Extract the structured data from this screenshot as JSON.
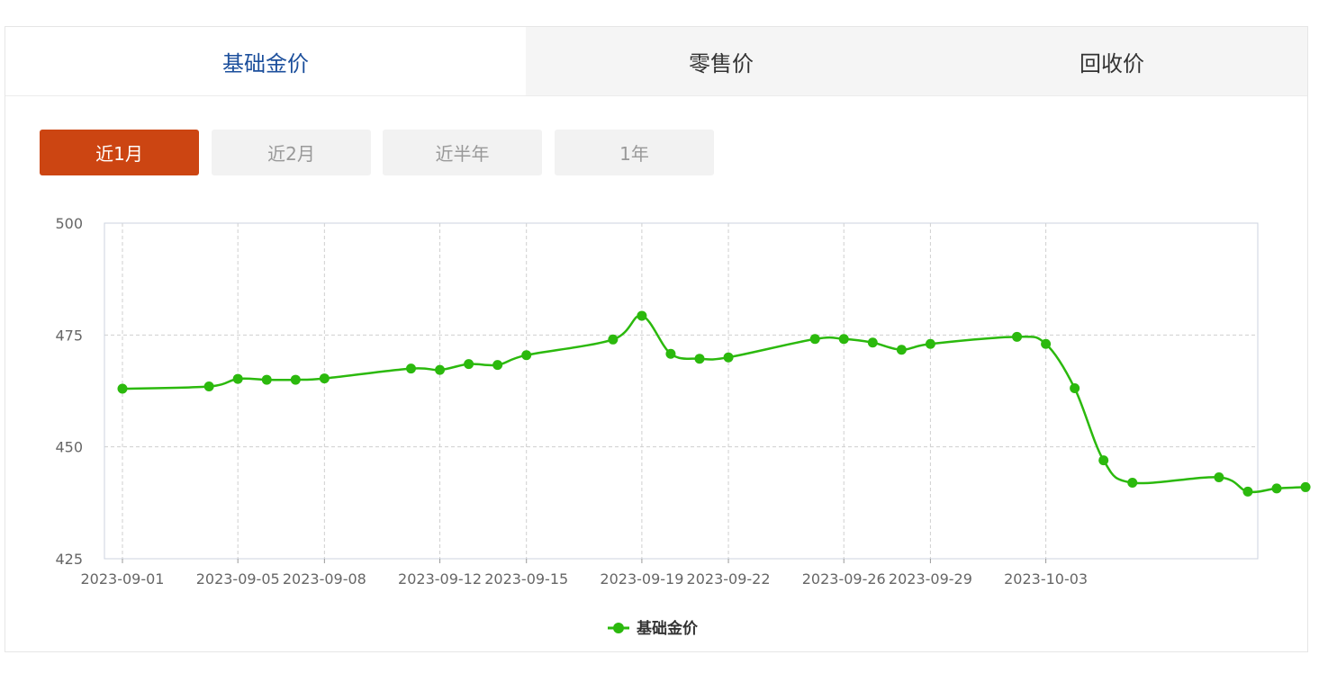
{
  "tabs": [
    {
      "label": "基础金价",
      "active": true
    },
    {
      "label": "零售价",
      "active": false
    },
    {
      "label": "回收价",
      "active": false
    }
  ],
  "ranges": [
    {
      "label": "近1月",
      "active": true
    },
    {
      "label": "近2月",
      "active": false
    },
    {
      "label": "近半年",
      "active": false
    },
    {
      "label": "1年",
      "active": false
    }
  ],
  "colors": {
    "accent_tab": "#1c4f9c",
    "range_active": "#cc4512",
    "series": "#2bb90d"
  },
  "chart_data": {
    "type": "line",
    "title": "",
    "xlabel": "",
    "ylabel": "",
    "ylim": [
      425,
      500
    ],
    "yticks": [
      425,
      450,
      475,
      500
    ],
    "x_tick_labels": [
      "2023-09-01",
      "2023-09-05",
      "2023-09-08",
      "2023-09-12",
      "2023-09-15",
      "2023-09-19",
      "2023-09-22",
      "2023-09-26",
      "2023-09-29",
      "2023-10-03"
    ],
    "grid": true,
    "legend_position": "bottom-center",
    "series": [
      {
        "name": "基础金价",
        "x": [
          "2023-09-01",
          "2023-09-04",
          "2023-09-05",
          "2023-09-06",
          "2023-09-07",
          "2023-09-08",
          "2023-09-11",
          "2023-09-12",
          "2023-09-13",
          "2023-09-14",
          "2023-09-15",
          "2023-09-18",
          "2023-09-19",
          "2023-09-20",
          "2023-09-21",
          "2023-09-22",
          "2023-09-25",
          "2023-09-26",
          "2023-09-27",
          "2023-09-28",
          "2023-09-29",
          "2023-10-02",
          "2023-10-03",
          "2023-10-04",
          "2023-10-05",
          "2023-10-06",
          "2023-10-09",
          "2023-10-10",
          "2023-10-11",
          "2023-10-12"
        ],
        "values": [
          463,
          463.5,
          465.2,
          465,
          465,
          465.3,
          467.5,
          467.2,
          468.5,
          468.3,
          470.5,
          474,
          479.3,
          470.8,
          469.7,
          470,
          474.1,
          474.1,
          473.3,
          471.7,
          473,
          474.6,
          473,
          463.1,
          447,
          442,
          443.2,
          440,
          440.7,
          441
        ]
      }
    ]
  }
}
